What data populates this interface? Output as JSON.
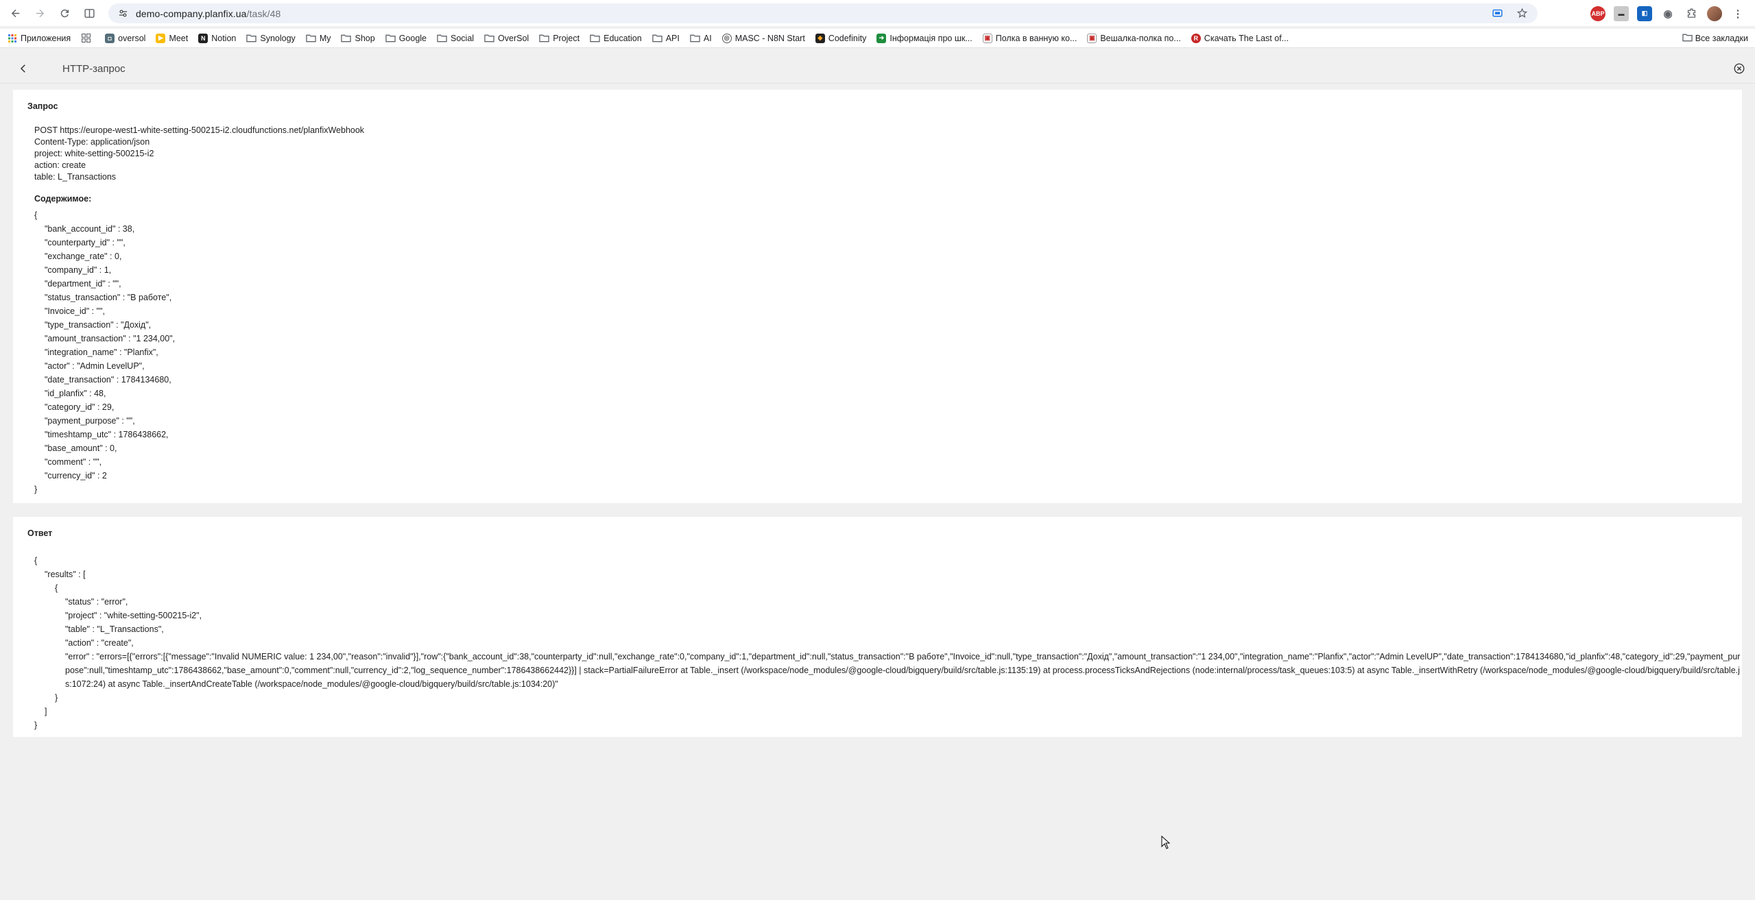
{
  "browser": {
    "url_host": "demo-company.planfix.ua",
    "url_path": "/task/48",
    "bookmarks": [
      {
        "label": "Приложения",
        "icon": "apps-grid-icon"
      },
      {
        "label": "",
        "icon": "tab-groups-icon"
      },
      {
        "label": "oversol",
        "icon": "site-favicon"
      },
      {
        "label": "Meet",
        "icon": "meet-favicon"
      },
      {
        "label": "Notion",
        "icon": "notion-favicon"
      },
      {
        "label": "Synology",
        "icon": "folder-icon"
      },
      {
        "label": "My",
        "icon": "folder-icon"
      },
      {
        "label": "Shop",
        "icon": "folder-icon"
      },
      {
        "label": "Google",
        "icon": "folder-icon"
      },
      {
        "label": "Social",
        "icon": "folder-icon"
      },
      {
        "label": "OverSol",
        "icon": "folder-icon"
      },
      {
        "label": "Project",
        "icon": "folder-icon"
      },
      {
        "label": "Education",
        "icon": "folder-icon"
      },
      {
        "label": "API",
        "icon": "folder-icon"
      },
      {
        "label": "AI",
        "icon": "folder-icon"
      },
      {
        "label": "MASC - N8N Start",
        "icon": "masc-favicon"
      },
      {
        "label": "Codefinity",
        "icon": "codefinity-favicon"
      },
      {
        "label": "Інформація про шк...",
        "icon": "green-favicon"
      },
      {
        "label": "Полка в ванную ко...",
        "icon": "shop-favicon"
      },
      {
        "label": "Вешалка-полка по...",
        "icon": "shop-favicon"
      },
      {
        "label": "Скачать The Last of...",
        "icon": "red-favicon"
      }
    ],
    "all_bookmarks": "Все закладки"
  },
  "header": {
    "title": "HTTP-запрос"
  },
  "request": {
    "title": "Запрос",
    "head_lines": [
      "POST https://europe-west1-white-setting-500215-i2.cloudfunctions.net/planfixWebhook",
      "Content-Type: application/json",
      "project: white-setting-500215-i2",
      "action: create",
      "table: L_Transactions"
    ],
    "content_label": "Содержимое:",
    "open_brace": "{",
    "close_brace": "}",
    "fields": [
      "\"bank_account_id\" : 38,",
      "\"counterparty_id\" : \"\",",
      "\"exchange_rate\" : 0,",
      "\"company_id\" : 1,",
      "\"department_id\" : \"\",",
      "\"status_transaction\" : \"В работе\",",
      "\"Invoice_id\" : \"\",",
      "\"type_transaction\" : \"Дохід\",",
      "\"amount_transaction\" : \"1 234,00\",",
      "\"integration_name\" : \"Planfix\",",
      "\"actor\" : \"Admin LevelUP\",",
      "\"date_transaction\" : 1784134680,",
      "\"id_planfix\" : 48,",
      "\"category_id\" : 29,",
      "\"payment_purpose\" : \"\",",
      "\"timeshtamp_utc\" : 1786438662,",
      "\"base_amount\" : 0,",
      "\"comment\" : \"\",",
      "\"currency_id\" : 2"
    ]
  },
  "response": {
    "title": "Ответ",
    "open_brace": "{",
    "results_open": "\"results\" : [",
    "item_open": "{",
    "status": "\"status\" : \"error\",",
    "project": "\"project\" : \"white-setting-500215-i2\",",
    "table": "\"table\" : \"L_Transactions\",",
    "action": "\"action\" : \"create\",",
    "error": "\"error\" : \"errors=[{\"errors\":[{\"message\":\"Invalid NUMERIC value: 1 234,00\",\"reason\":\"invalid\"}],\"row\":{\"bank_account_id\":38,\"counterparty_id\":null,\"exchange_rate\":0,\"company_id\":1,\"department_id\":null,\"status_transaction\":\"В работе\",\"Invoice_id\":null,\"type_transaction\":\"Дохід\",\"amount_transaction\":\"1 234,00\",\"integration_name\":\"Planfix\",\"actor\":\"Admin LevelUP\",\"date_transaction\":1784134680,\"id_planfix\":48,\"category_id\":29,\"payment_purpose\":null,\"timeshtamp_utc\":1786438662,\"base_amount\":0,\"comment\":null,\"currency_id\":2,\"log_sequence_number\":1786438662442}}] | stack=PartialFailureError at Table._insert (/workspace/node_modules/@google-cloud/bigquery/build/src/table.js:1135:19) at process.processTicksAndRejections (node:internal/process/task_queues:103:5) at async Table._insertWithRetry (/workspace/node_modules/@google-cloud/bigquery/build/src/table.js:1072:24) at async Table._insertAndCreateTable (/workspace/node_modules/@google-cloud/bigquery/build/src/table.js:1034:20)\"",
    "item_close": "}",
    "results_close": "]",
    "close_brace": "}"
  }
}
